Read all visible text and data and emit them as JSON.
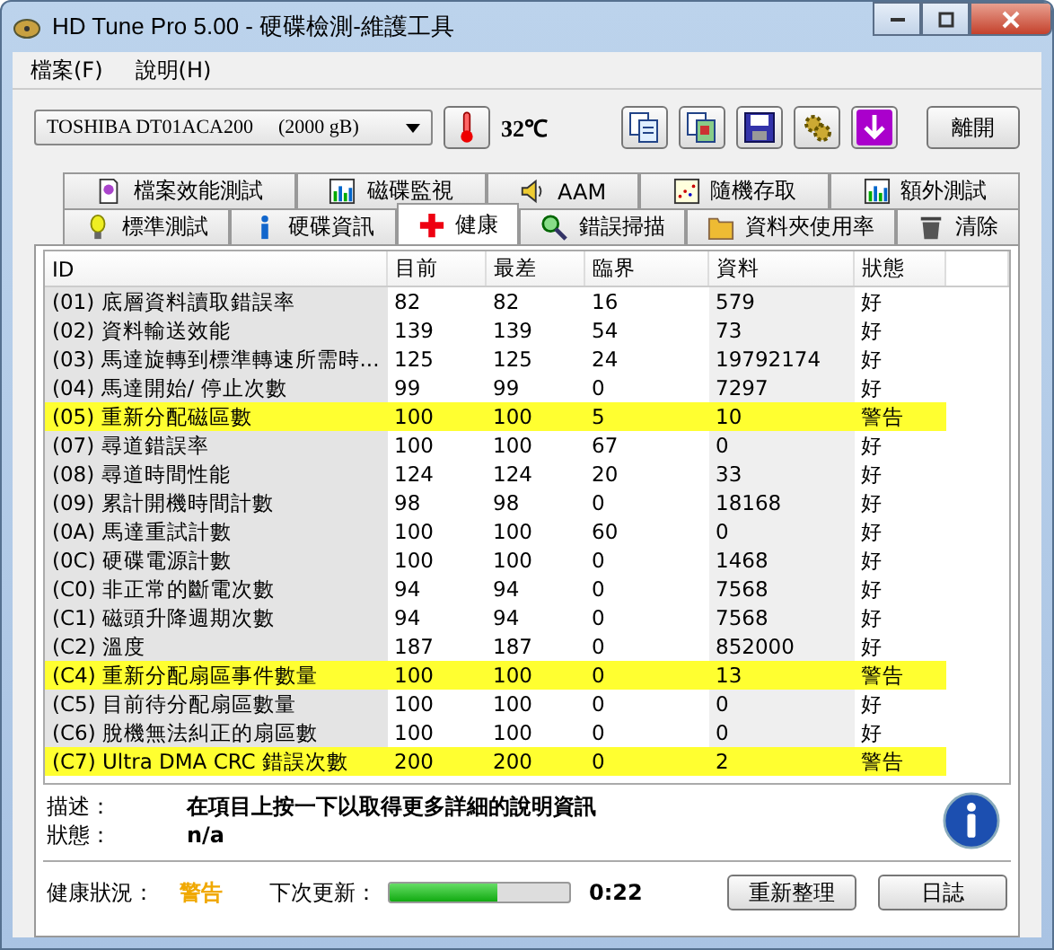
{
  "window": {
    "title": "HD Tune Pro  5.00 - 硬碟檢測-維護工具"
  },
  "menu": [
    "檔案(F)",
    "說明(H)"
  ],
  "toolbar": {
    "drive": "TOSHIBA DT01ACA200",
    "capacity": "(2000 gB)",
    "temperature": "32℃",
    "exit": "離開"
  },
  "tabs_top": [
    {
      "label": "檔案效能測試",
      "selected": false
    },
    {
      "label": "磁碟監視",
      "selected": false
    },
    {
      "label": "AAM",
      "selected": false
    },
    {
      "label": "隨機存取",
      "selected": false
    },
    {
      "label": "額外測試",
      "selected": false
    }
  ],
  "tabs_bottom": [
    {
      "label": "標準測試",
      "selected": false
    },
    {
      "label": "硬碟資訊",
      "selected": false
    },
    {
      "label": "健康",
      "selected": true
    },
    {
      "label": "錯誤掃描",
      "selected": false
    },
    {
      "label": "資料夾使用率",
      "selected": false
    },
    {
      "label": "清除",
      "selected": false
    }
  ],
  "table": {
    "columns": [
      "ID",
      "目前",
      "最差",
      "臨界",
      "資料",
      "狀態"
    ],
    "rows": [
      {
        "cells": [
          "(01) 底層資料讀取錯誤率",
          "82",
          "82",
          "16",
          "579",
          "好"
        ],
        "warning": false
      },
      {
        "cells": [
          "(02) 資料輸送效能",
          "139",
          "139",
          "54",
          "73",
          "好"
        ],
        "warning": false
      },
      {
        "cells": [
          "(03) 馬達旋轉到標準轉速所需時...",
          "125",
          "125",
          "24",
          "19792174",
          "好"
        ],
        "warning": false
      },
      {
        "cells": [
          "(04) 馬達開始/ 停止次數",
          "99",
          "99",
          "0",
          "7297",
          "好"
        ],
        "warning": false
      },
      {
        "cells": [
          "(05) 重新分配磁區數",
          "100",
          "100",
          "5",
          "10",
          "警告"
        ],
        "warning": true
      },
      {
        "cells": [
          "(07) 尋道錯誤率",
          "100",
          "100",
          "67",
          "0",
          "好"
        ],
        "warning": false
      },
      {
        "cells": [
          "(08) 尋道時間性能",
          "124",
          "124",
          "20",
          "33",
          "好"
        ],
        "warning": false
      },
      {
        "cells": [
          "(09) 累計開機時間計數",
          "98",
          "98",
          "0",
          "18168",
          "好"
        ],
        "warning": false
      },
      {
        "cells": [
          "(0A) 馬達重試計數",
          "100",
          "100",
          "60",
          "0",
          "好"
        ],
        "warning": false
      },
      {
        "cells": [
          "(0C) 硬碟電源計數",
          "100",
          "100",
          "0",
          "1468",
          "好"
        ],
        "warning": false
      },
      {
        "cells": [
          "(C0) 非正常的斷電次數",
          "94",
          "94",
          "0",
          "7568",
          "好"
        ],
        "warning": false
      },
      {
        "cells": [
          "(C1) 磁頭升降週期次數",
          "94",
          "94",
          "0",
          "7568",
          "好"
        ],
        "warning": false
      },
      {
        "cells": [
          "(C2) 溫度",
          "187",
          "187",
          "0",
          "852000",
          "好"
        ],
        "warning": false
      },
      {
        "cells": [
          "(C4) 重新分配扇區事件數量",
          "100",
          "100",
          "0",
          "13",
          "警告"
        ],
        "warning": true
      },
      {
        "cells": [
          "(C5) 目前待分配扇區數量",
          "100",
          "100",
          "0",
          "0",
          "好"
        ],
        "warning": false
      },
      {
        "cells": [
          "(C6) 脫機無法糾正的扇區數",
          "100",
          "100",
          "0",
          "0",
          "好"
        ],
        "warning": false
      },
      {
        "cells": [
          "(C7) Ultra DMA CRC 錯誤次數",
          "200",
          "200",
          "0",
          "2",
          "警告"
        ],
        "warning": true
      }
    ]
  },
  "details": {
    "description_label": "描述：",
    "description": "在項目上按一下以取得更多詳細的說明資訊",
    "status_label": "狀態：",
    "status": "n/a"
  },
  "footer": {
    "health_label": "健康狀況：",
    "health": "警告",
    "next_update_label": "下次更新：",
    "level": 0.6,
    "countdown": "0:22",
    "refresh": "重新整理",
    "log": "日誌"
  }
}
